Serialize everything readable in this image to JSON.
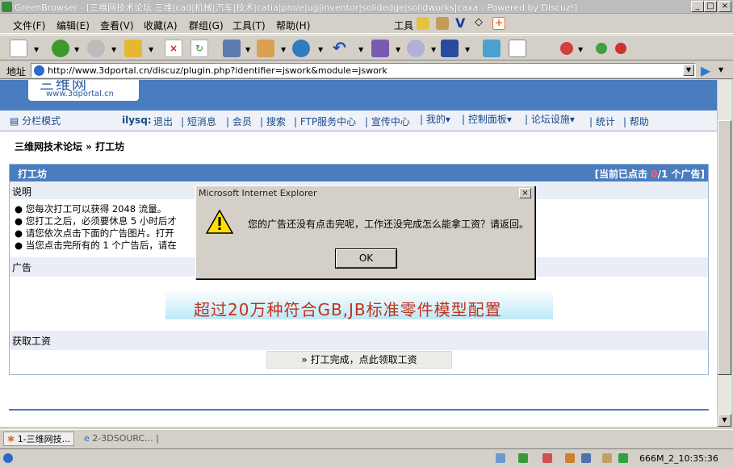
{
  "window": {
    "title": "GreenBrowser - [三维网技术论坛 三维|cad|机械|汽车|技术|catia|pro/e|ug|inventor|solidedge|solidworks|caxa - Powered by Discuz!]",
    "min": "_",
    "max": "□",
    "close": "×"
  },
  "menu": [
    "文件(F)",
    "编辑(E)",
    "查看(V)",
    "收藏(A)",
    "群组(G)",
    "工具(T)",
    "帮助(H)"
  ],
  "extras": {
    "tools": "工具"
  },
  "address": {
    "label": "地址",
    "url": "http://www.3dportal.cn/discuz/plugin.php?identifier=jswork&module=jswork"
  },
  "site": {
    "logo_text": "三维网",
    "logo_url": "www.3dportal.cn",
    "mode": "分栏模式",
    "user": "ilysq:",
    "nav": [
      "退出",
      "短消息",
      "会员",
      "搜索",
      "FTP服务中心",
      "宣传中心",
      "我的▾",
      "控制面板▾",
      "论坛设施▾",
      "统计",
      "帮助"
    ]
  },
  "breadcrumb": "三维网技术论坛 » 打工坊",
  "section": {
    "title": "打工坊",
    "counter_prefix": "[当前已点击 ",
    "counter_clicked": "0",
    "counter_suffix": "/1 个广告]",
    "desc_label": "说明",
    "bullets": [
      "您每次打工可以获得 2048 流量。",
      "您打工之后，必须要休息 5 小时后才",
      "请您依次点击下面的广告图片。打开",
      "当您点击完所有的 1 个广告后，请在"
    ],
    "ad_label": "广告",
    "ad_banner": "超过20万种符合GB,JB标准零件模型配置",
    "wage_label": "获取工资",
    "wage_button": "» 打工完成，点此领取工资"
  },
  "dialog": {
    "title": "Microsoft Internet Explorer",
    "message": "您的广告还没有点击完呢，工作还没完成怎么能拿工资？请返回。",
    "ok": "OK",
    "close": "×"
  },
  "tabs": [
    "1-三维网技...",
    "2-3DSOURC..."
  ],
  "status": {
    "time": "666M_2_10:35:36"
  },
  "colors": {
    "header": "#4a7cc0",
    "banner_text": "#c3301c",
    "counter": "#cc0000"
  }
}
